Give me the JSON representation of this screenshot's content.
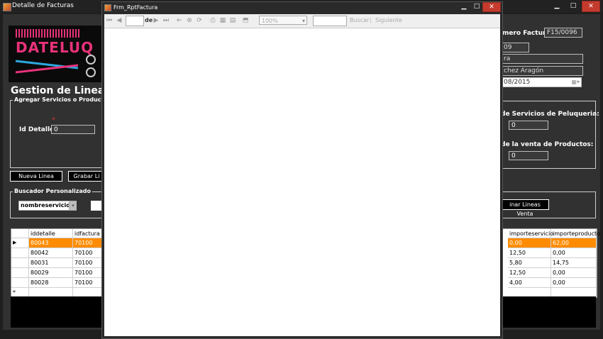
{
  "main_window": {
    "title": "Detalle de Facturas",
    "min_icon": "▁",
    "max_icon": "□",
    "close_icon": "✕"
  },
  "logo": {
    "text": "DATELUQ"
  },
  "page_title": "Gestion de Lineas d",
  "agregar_group": {
    "label": "Agregar Servicios o Productos",
    "required_mark": "*",
    "id_detalle_label": "Id Detalle",
    "id_detalle_value": "0"
  },
  "buttons": {
    "nueva_linea": "Nueva Linea",
    "grabar_linea": "Grabar Li",
    "eliminar_lineas": "inar Lineas Venta"
  },
  "buscador_group": {
    "label": "Buscador Personalizado",
    "field_select": "nombreservicio",
    "select_arrow": "▾"
  },
  "invoice_header": {
    "numero_label": "mero Factura:",
    "numero_value": "F15/0096",
    "field2": "09",
    "field3": "ra",
    "field4": "chez Aragón",
    "date_value": "08/2015"
  },
  "totals": {
    "servicios_label": "de Servicios de Peluqueria:",
    "servicios_value": "0",
    "productos_label": "de la venta de Productos:",
    "productos_value": "0"
  },
  "grid": {
    "left_headers": [
      "iddetalle",
      "idfactura"
    ],
    "right_headers": [
      "importeservicio",
      "importeproducto"
    ],
    "row_marker": "▶",
    "new_row_marker": "*",
    "rows": [
      {
        "iddetalle": "80043",
        "idfactura": "70100",
        "importeservicio": "0,00",
        "importeproducto": "62,00"
      },
      {
        "iddetalle": "80042",
        "idfactura": "70100",
        "importeservicio": "12,50",
        "importeproducto": "0,00"
      },
      {
        "iddetalle": "80031",
        "idfactura": "70100",
        "importeservicio": "5,80",
        "importeproducto": "14,75"
      },
      {
        "iddetalle": "80029",
        "idfactura": "70100",
        "importeservicio": "12,50",
        "importeproducto": "0,00"
      },
      {
        "iddetalle": "80028",
        "idfactura": "70100",
        "importeservicio": "4,00",
        "importeproducto": "0,00"
      }
    ]
  },
  "report_window": {
    "title": "Frm_RptFactura",
    "page_of": "de",
    "zoom": "100%",
    "buscar": "Buscar",
    "separator": "|",
    "siguiente": "Siguiente",
    "icons": {
      "first": "⏮",
      "prev": "◀",
      "next": "▶",
      "last": "⏭",
      "back": "⇤",
      "stop": "⊗",
      "refresh": "⟳",
      "print": "⎙",
      "print_layout": "▦",
      "page_setup": "▤",
      "export": "⬒"
    }
  }
}
